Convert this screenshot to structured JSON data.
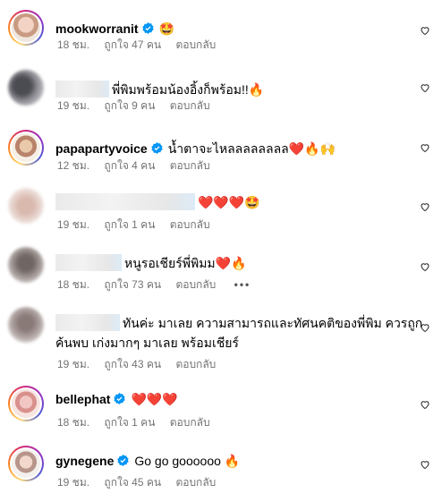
{
  "comments": [
    {
      "username": "mookworranit",
      "verified": true,
      "text": "🤩",
      "time": "18 ชม.",
      "likes": "ถูกใจ 47 คน",
      "reply": "ตอบกลับ"
    },
    {
      "username": "",
      "verified": false,
      "text": "พี่พิมพร้อมน้องอิ้งก็พร้อม!!🔥",
      "time": "19 ชม.",
      "likes": "ถูกใจ 9 คน",
      "reply": "ตอบกลับ"
    },
    {
      "username": "papapartyvoice",
      "verified": true,
      "text": "น้ำตาจะไหลลลลลลลล❤️🔥🙌",
      "time": "12 ชม.",
      "likes": "ถูกใจ 4 คน",
      "reply": "ตอบกลับ"
    },
    {
      "username": "",
      "verified": false,
      "text": "❤️❤️❤️🤩",
      "time": "19 ชม.",
      "likes": "ถูกใจ 1 คน",
      "reply": "ตอบกลับ"
    },
    {
      "username": "",
      "verified": false,
      "text": "หนูรอเชียร์พี่พิมม❤️🔥",
      "time": "18 ชม.",
      "likes": "ถูกใจ 73 คน",
      "reply": "ตอบกลับ",
      "more": "•••"
    },
    {
      "username": "",
      "verified": false,
      "text": "ทันค่ะ มาเลย ความสามารถและทัศนคติของพี่พิม ควรถูกค้นพบ เก่งมากๆ มาเลย พร้อมเชียร์",
      "time": "19 ชม.",
      "likes": "ถูกใจ 43 คน",
      "reply": "ตอบกลับ"
    },
    {
      "username": "bellephat",
      "verified": true,
      "text": "❤️❤️❤️",
      "time": "18 ชม.",
      "likes": "ถูกใจ 1 คน",
      "reply": "ตอบกลับ"
    },
    {
      "username": "gynegene",
      "verified": true,
      "text": "Go go goooooo 🔥",
      "time": "19 ชม.",
      "likes": "ถูกใจ 45 คน",
      "reply": "ตอบกลับ"
    }
  ],
  "colors": {
    "verified": "#0095f6",
    "meta": "#737373",
    "heart_outline": "#262626"
  },
  "icons": {
    "like": "heart-outline-icon",
    "verified": "verified-badge-icon"
  }
}
